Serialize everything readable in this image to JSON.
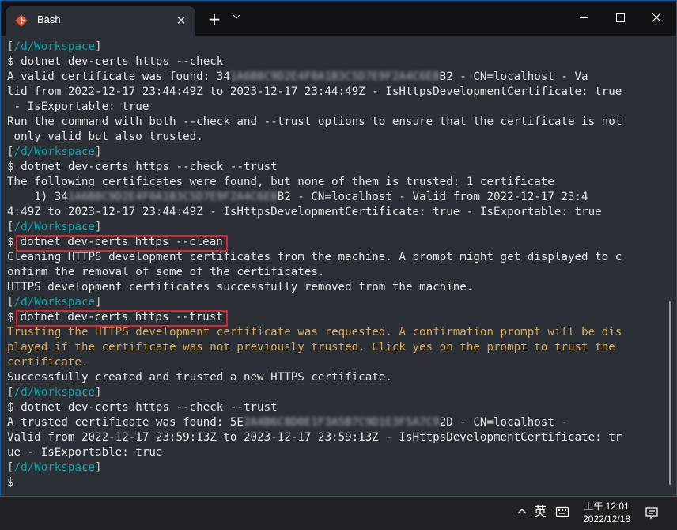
{
  "window": {
    "tab_title": "Bash",
    "tab_close": "✕",
    "new_tab": "+",
    "dropdown": "⌄"
  },
  "terminal": {
    "path": "/d/Workspace",
    "lines": {
      "l2": "$ dotnet dev-certs https --check",
      "l3_a": "A valid certificate was found: 34",
      "l3_b": "1A6B8C9D2E4F0A1B3C5D7E9F2A4C6E8",
      "l3_c": "B2 - CN=localhost - Va",
      "l4": "lid from 2022-12-17 23:44:49Z to 2023-12-17 23:44:49Z - IsHttpsDevelopmentCertificate: true",
      "l5": " - IsExportable: true",
      "l6": "Run the command with both --check and --trust options to ensure that the certificate is not",
      "l7": " only valid but also trusted.",
      "l9": "$ dotnet dev-certs https --check --trust",
      "l10": "The following certificates were found, but none of them is trusted: 1 certificate",
      "l11_a": "    1) 34",
      "l11_b": "1A6B8C9D2E4F0A1B3C5D7E9F2A4C6E8",
      "l11_c": "B2 - CN=localhost - Valid from 2022-12-17 23:4",
      "l12": "4:49Z to 2023-12-17 23:44:49Z - IsHttpsDevelopmentCertificate: true - IsExportable: true",
      "l14_cmd": "dotnet dev-certs https --clean",
      "l15": "Cleaning HTTPS development certificates from the machine. A prompt might get displayed to c",
      "l16": "onfirm the removal of some of the certificates.",
      "l17": "HTTPS development certificates successfully removed from the machine.",
      "l19_cmd": "dotnet dev-certs https --trust",
      "l20": "Trusting the HTTPS development certificate was requested. A confirmation prompt will be dis",
      "l21": "played if the certificate was not previously trusted. Click yes on the prompt to trust the",
      "l22": "certificate.",
      "l23": "Successfully created and trusted a new HTTPS certificate.",
      "l25": "$ dotnet dev-certs https --check --trust",
      "l26_a": "A trusted certificate was found: 5E",
      "l26_b": "2A4B6C8D0E1F3A5B7C9D1E3F5A7C9",
      "l26_c": "2D - CN=localhost -",
      "l27": "Valid from 2022-12-17 23:59:13Z to 2023-12-17 23:59:13Z - IsHttpsDevelopmentCertificate: tr",
      "l28": "ue - IsExportable: true",
      "l30": "$"
    }
  },
  "taskbar": {
    "chevron": "^",
    "ime": "英",
    "time": "上午 12:01",
    "date": "2022/12/18"
  },
  "colors": {
    "path": "#0fa3a3",
    "warning": "#d6a85a",
    "highlight": "#e0232e",
    "text": "#e6e6e6"
  },
  "icons": [
    "git-bash-icon",
    "close-icon",
    "plus-icon",
    "chevron-down-icon",
    "minimize-icon",
    "maximize-icon",
    "keyboard-icon",
    "notification-icon"
  ]
}
